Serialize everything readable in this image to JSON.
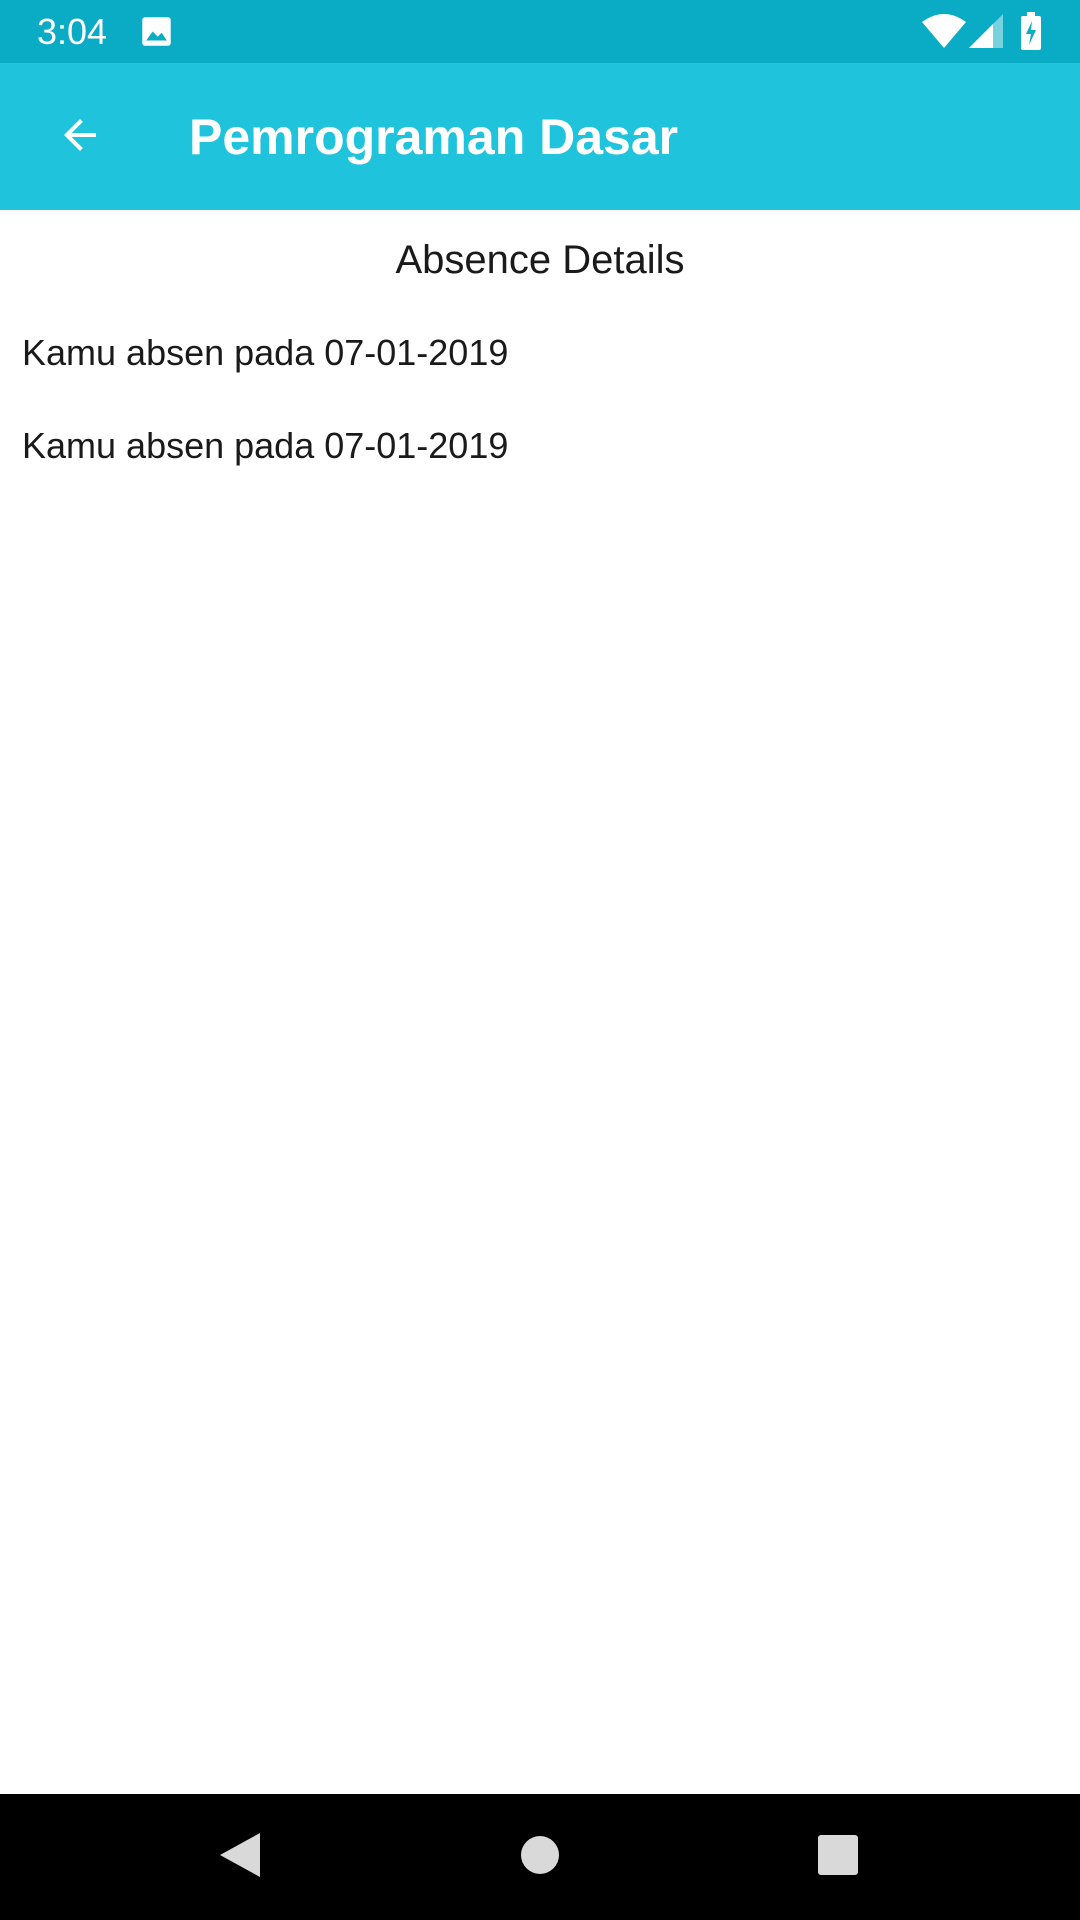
{
  "status_bar": {
    "time": "3:04",
    "icons": [
      "image-icon",
      "wifi-icon",
      "signal-icon",
      "battery-charging-icon"
    ],
    "background_color": "#0AABC5"
  },
  "app_bar": {
    "title": "Pemrograman Dasar",
    "back_icon": "arrow-back-icon",
    "background_color": "#1FC3DC"
  },
  "main": {
    "heading": "Absence Details",
    "absence_items": [
      {
        "text": "Kamu absen pada 07-01-2019"
      },
      {
        "text": "Kamu absen pada 07-01-2019"
      }
    ]
  },
  "nav_bar": {
    "buttons": [
      "nav-back-icon",
      "nav-home-icon",
      "nav-recents-icon"
    ]
  }
}
